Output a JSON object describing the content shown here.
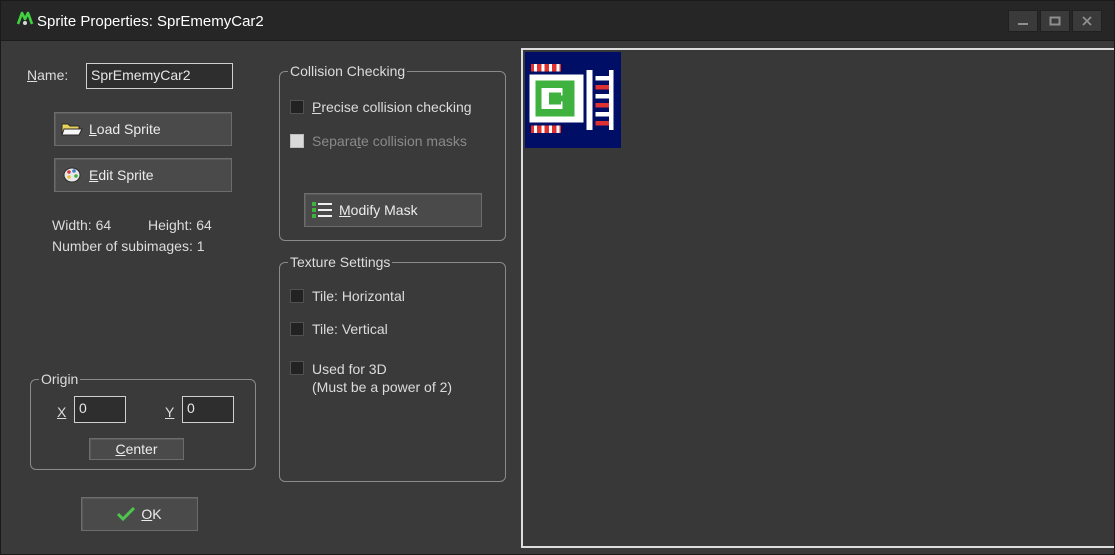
{
  "window": {
    "title": "Sprite Properties: SprEmemyCar2",
    "controls": [
      "minimize",
      "maximize",
      "close"
    ]
  },
  "name_field": {
    "label": "Name:",
    "value": "SprEmemyCar2"
  },
  "buttons": {
    "load_sprite": "Load Sprite",
    "edit_sprite": "Edit Sprite",
    "modify_mask": "Modify Mask",
    "center": "Center",
    "ok": "OK"
  },
  "sprite_info": {
    "width": "Width: 64",
    "height": "Height: 64",
    "subimages": "Number of subimages: 1"
  },
  "origin": {
    "title": "Origin",
    "x_label": "X",
    "x_value": "0",
    "y_label": "Y",
    "y_value": "0"
  },
  "collision": {
    "title": "Collision Checking",
    "precise": {
      "label": "Precise collision checking",
      "checked": false
    },
    "separate": {
      "label": "Separate collision masks",
      "checked": false,
      "enabled": false
    }
  },
  "texture": {
    "title": "Texture Settings",
    "tile_h": {
      "label": "Tile: Horizontal",
      "checked": false
    },
    "tile_v": {
      "label": "Tile: Vertical",
      "checked": false
    },
    "used_3d": {
      "label": "Used for 3D",
      "note": "(Must be a power of 2)",
      "checked": false
    }
  },
  "colors": {
    "title_bar": "#262626",
    "panel": "#3a3a3a",
    "sprite_background": "#000e66",
    "accent_green": "#3fb13f"
  },
  "icons": {
    "app": "game-maker-icon",
    "load": "folder-open-icon",
    "edit": "paint-palette-icon",
    "mask": "mask-list-icon",
    "ok": "checkmark-icon"
  }
}
